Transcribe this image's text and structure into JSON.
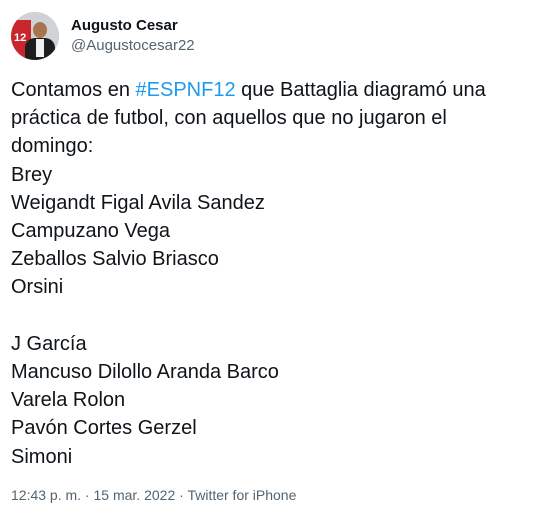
{
  "author": {
    "display_name": "Augusto Cesar",
    "handle": "@Augustocesar22",
    "avatar_label": "12"
  },
  "tweet": {
    "intro_prefix": "Contamos en ",
    "hashtag": "#ESPNF12",
    "intro_suffix": " que Battaglia diagramó una",
    "line2": "práctica de futbol, con aquellos que no jugaron el",
    "line3": "domingo:",
    "lines_group1": [
      "Brey",
      "Weigandt Figal Avila Sandez",
      "Campuzano Vega",
      "Zeballos Salvio Briasco",
      "Orsini"
    ],
    "lines_group2": [
      "J García",
      "Mancuso Dilollo Aranda Barco",
      "Varela Rolon",
      "Pavón Cortes Gerzel",
      "Simoni"
    ]
  },
  "meta": {
    "time": "12:43 p. m.",
    "separator1": " · ",
    "date": "15 mar. 2022",
    "separator2": " · ",
    "source": "Twitter for iPhone"
  },
  "colors": {
    "hashtag": "#1d9bf0",
    "secondary_text": "#536471",
    "primary_text": "#0f1419"
  }
}
